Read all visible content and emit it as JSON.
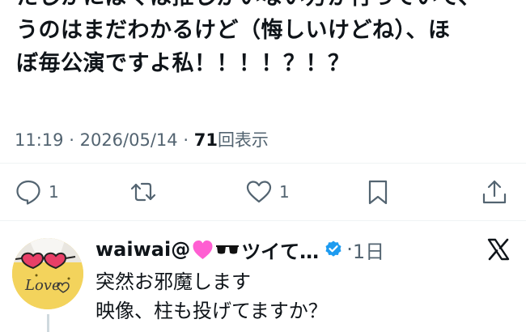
{
  "tweet": {
    "lines": [
      "たしかにぼくは推しがいない方が行っていて、",
      "うのはまだわかるけど（悔しいけどね）、ほ",
      "ぼ毎公演ですよ私！！！！？！？"
    ]
  },
  "meta": {
    "time": "11:19",
    "separator": "·",
    "date": "2026/05/14",
    "views_count": "71",
    "views_label": "回表示"
  },
  "actions": {
    "reply_count": "1",
    "like_count": "1",
    "icons": [
      "reply-icon",
      "retweet-icon",
      "like-icon",
      "bookmark-icon",
      "share-icon"
    ]
  },
  "reply": {
    "name": "waiwai@",
    "name_suffix": "ツイて…",
    "separator": "·",
    "time": "1日",
    "avatar_text": "Love",
    "text_lines": [
      "突然お邪魔します",
      "映像、柱も投げてますか？"
    ]
  },
  "colors": {
    "text": "#0f1419",
    "secondary": "#536471",
    "verified": "#1d9bf0",
    "divider": "#eff3f4",
    "heart": "#ff5fd2"
  }
}
